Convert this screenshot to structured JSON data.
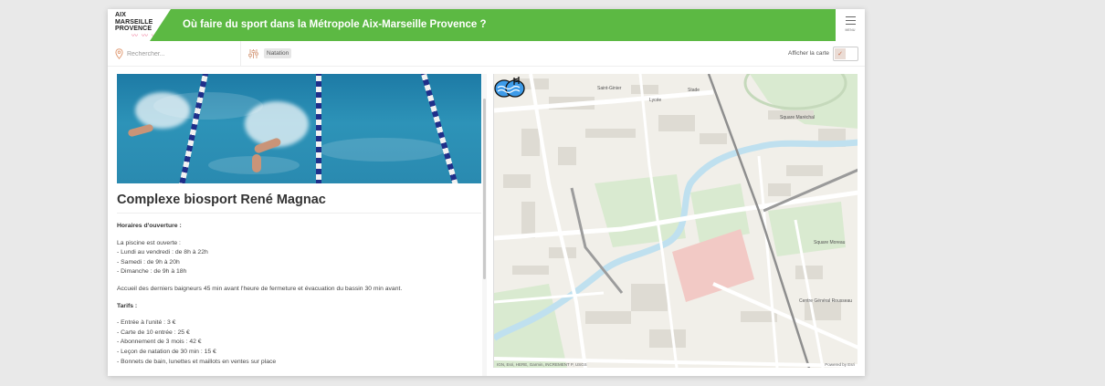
{
  "header": {
    "logo_lines": [
      "AIX",
      "MARSEILLE",
      "PROVENCE"
    ],
    "logo_wave": "~",
    "title": "Où faire du sport dans la Métropole Aix-Marseille Provence ?",
    "menu_label": "MENU"
  },
  "toolbar": {
    "search_placeholder": "Rechercher...",
    "active_filter": "Natation",
    "map_toggle_label": "Afficher la carte",
    "map_toggle_on": true,
    "map_toggle_mark": "✓"
  },
  "place": {
    "name": "Complexe biosport René Magnac",
    "hours_heading": "Horaires d'ouverture :",
    "hours_intro": "La piscine est ouverte :",
    "hours": [
      "- Lundi au vendredi : de 8h à 22h",
      "- Samedi : de 9h à 20h",
      "- Dimanche : de 9h à 18h"
    ],
    "note": "Accueil des derniers baigneurs 45 min avant l'heure de fermeture et évacuation du bassin 30 min avant.",
    "prices_heading": "Tarifs :",
    "prices": [
      "- Entrée à l'unité : 3 €",
      "- Carte de 10 entrée : 25 €",
      "- Abonnement de 3 mois : 42 €",
      "- Leçon de natation de 30 min : 15 €",
      "- Bonnets de bain, lunettes et maillots en ventes sur place"
    ]
  },
  "map": {
    "zoom_in": "+",
    "zoom_out": "−",
    "attribution": "IGN, Esri, HERE, Garmin, INCREMENT P, USGS",
    "powered_by": "Powered by Esri",
    "labels": [
      "Saint-Ginier",
      "Square Maréchal",
      "Square Moreau",
      "Lycée",
      "Stade",
      "Centre Général Rousseau"
    ],
    "marker_icon": "swimming-pool-icon",
    "colors": {
      "river": "#bfe0ef",
      "park": "#d9ead0",
      "road": "#ffffff",
      "building": "#dedbd3",
      "rail": "#8e8e8e",
      "sports": "#f2c9c5"
    }
  },
  "colors": {
    "brand_green": "#5cb943",
    "toggle_mark": "#c86b4a"
  }
}
